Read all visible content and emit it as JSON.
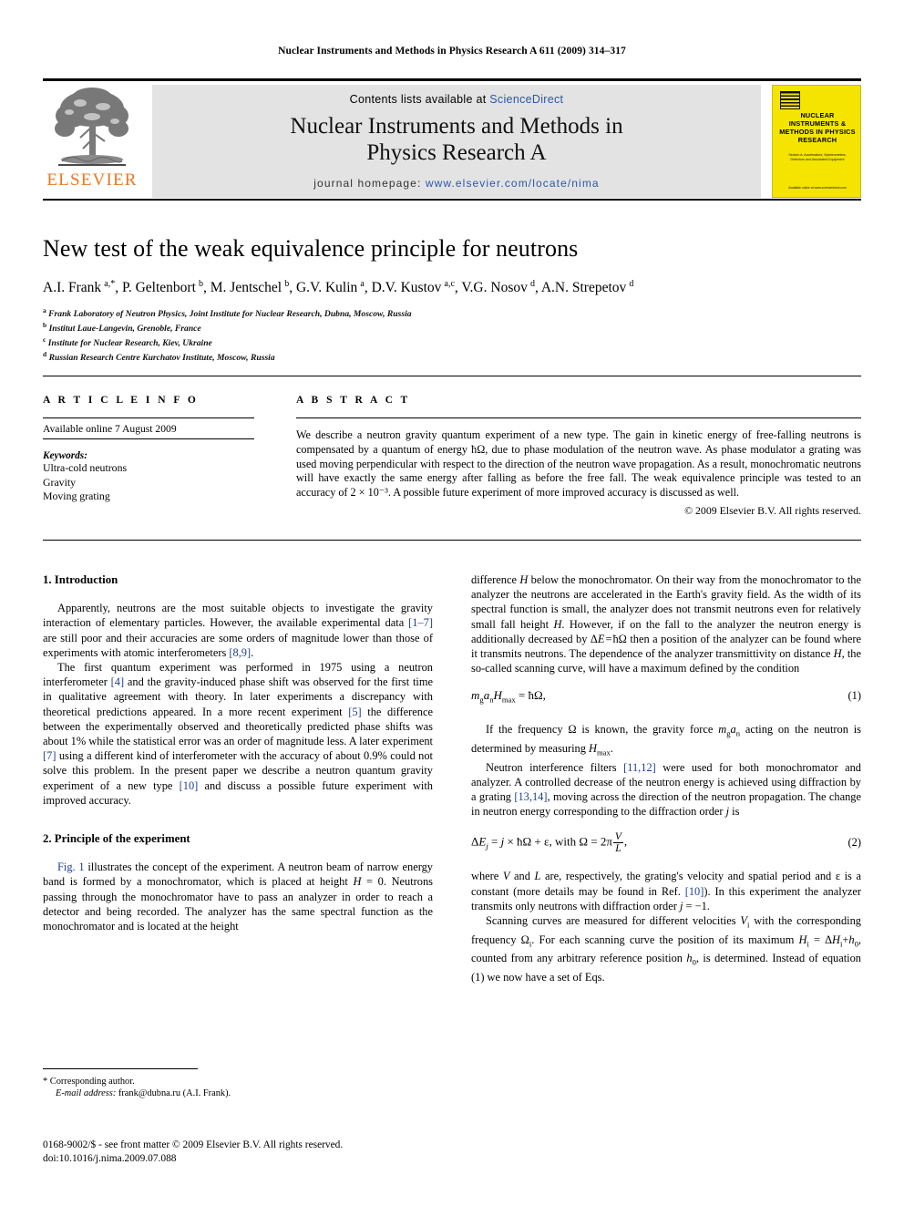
{
  "running_head": "Nuclear Instruments and Methods in Physics Research A 611 (2009) 314–317",
  "masthead": {
    "publisher": "ELSEVIER",
    "contents_prefix": "Contents lists available at",
    "contents_link": "ScienceDirect",
    "journal_name_line1": "Nuclear Instruments and Methods in",
    "journal_name_line2": "Physics Research A",
    "homepage_prefix": "journal homepage:",
    "homepage_url": "www.elsevier.com/locate/nima",
    "cover": {
      "title": "NUCLEAR INSTRUMENTS & METHODS IN PHYSICS RESEARCH",
      "subtitle": "Section A: Accelerators, Spectrometers, Detectors and Associated Equipment",
      "footer": "Available online at www.sciencedirect.com"
    }
  },
  "title": "New test of the weak equivalence principle for neutrons",
  "authors": "A.I. Frank a,*, P. Geltenbort b, M. Jentschel b, G.V. Kulin a, D.V. Kustov a,c, V.G. Nosov d, A.N. Strepetov d",
  "affiliations": [
    {
      "marker": "a",
      "text": "Frank Laboratory of Neutron Physics, Joint Institute for Nuclear Research, Dubna, Moscow, Russia"
    },
    {
      "marker": "b",
      "text": "Institut Laue-Langevin, Grenoble, France"
    },
    {
      "marker": "c",
      "text": "Institute for Nuclear Research, Kiev, Ukraine"
    },
    {
      "marker": "d",
      "text": "Russian Research Centre Kurchatov Institute, Moscow, Russia"
    }
  ],
  "article_info": {
    "heading": "A R T I C L E   I N F O",
    "available_online": "Available online 7 August 2009",
    "keywords_label": "Keywords:",
    "keywords": [
      "Ultra-cold neutrons",
      "Gravity",
      "Moving grating"
    ]
  },
  "abstract": {
    "heading": "A B S T R A C T",
    "text": "We describe a neutron gravity quantum experiment of a new type. The gain in kinetic energy of free-falling neutrons is compensated by a quantum of energy ħΩ, due to phase modulation of the neutron wave. As phase modulator a grating was used moving perpendicular with respect to the direction of the neutron wave propagation. As a result, monochromatic neutrons will have exactly the same energy after falling as before the free fall. The weak equivalence principle was tested to an accuracy of 2 × 10⁻³. A possible future experiment of more improved accuracy is discussed as well.",
    "copyright": "© 2009 Elsevier B.V. All rights reserved."
  },
  "sections": {
    "intro_heading": "1. Introduction",
    "intro_p1": "Apparently, neutrons are the most suitable objects to investigate the gravity interaction of elementary particles. However, the available experimental data [1–7] are still poor and their accuracies are some orders of magnitude lower than those of experiments with atomic interferometers [8,9].",
    "intro_p2": "The first quantum experiment was performed in 1975 using a neutron interferometer [4] and the gravity-induced phase shift was observed for the first time in qualitative agreement with theory. In later experiments a discrepancy with theoretical predictions appeared. In a more recent experiment [5] the difference between the experimentally observed and theoretically predicted phase shifts was about 1% while the statistical error was an order of magnitude less. A later experiment [7] using a different kind of interferometer with the accuracy of about 0.9% could not solve this problem. In the present paper we describe a neutron quantum gravity experiment of a new type [10] and discuss a possible future experiment with improved accuracy.",
    "principle_heading": "2. Principle of the experiment",
    "principle_p1": "Fig. 1 illustrates the concept of the experiment. A neutron beam of narrow energy band is formed by a monochromator, which is placed at height H = 0. Neutrons passing through the monochromator have to pass an analyzer in order to reach a detector and being recorded. The analyzer has the same spectral function as the monochromator and is located at the height",
    "right_p1": "difference H below the monochromator. On their way from the monochromator to the analyzer the neutrons are accelerated in the Earth's gravity field. As the width of its spectral function is small, the analyzer does not transmit neutrons even for relatively small fall height H. However, if on the fall to the analyzer the neutron energy is additionally decreased by ΔE = ħΩ then a position of the analyzer can be found where it transmits neutrons. The dependence of the analyzer transmittivity on distance H, the so-called scanning curve, will have a maximum defined by the condition",
    "right_p2": "If the frequency Ω is known, the gravity force mgan acting on the neutron is determined by measuring Hmax.",
    "right_p3": "Neutron interference filters [11,12] were used for both monochromator and analyzer. A controlled decrease of the neutron energy is achieved using diffraction by a grating [13,14], moving across the direction of the neutron propagation. The change in neutron energy corresponding to the diffraction order j is",
    "right_p4": "where V and L are, respectively, the grating's velocity and spatial period and ε is a constant (more details may be found in Ref. [10]). In this experiment the analyzer transmits only neutrons with diffraction order j = −1.",
    "right_p5": "Scanning curves are measured for different velocities Vi with the corresponding frequency Ωi. For each scanning curve the position of its maximum Hi = ΔHi+h0, counted from any arbitrary reference position h0, is determined. Instead of equation (1) we now have a set of Eqs."
  },
  "equations": {
    "eq1_number": "(1)",
    "eq2_number": "(2)"
  },
  "footnote": {
    "corresponding": "* Corresponding author.",
    "email_label": "E-mail address:",
    "email": "frank@dubna.ru (A.I. Frank)."
  },
  "imprint": {
    "line1": "0168-9002/$ - see front matter © 2009 Elsevier B.V. All rights reserved.",
    "line2": "doi:10.1016/j.nima.2009.07.088"
  },
  "colors": {
    "link": "#2b57a8",
    "reference": "#1f3f92",
    "elsevier_orange": "#E87722",
    "cover_yellow": "#F5E400",
    "band_gray": "#e3e3e3"
  }
}
